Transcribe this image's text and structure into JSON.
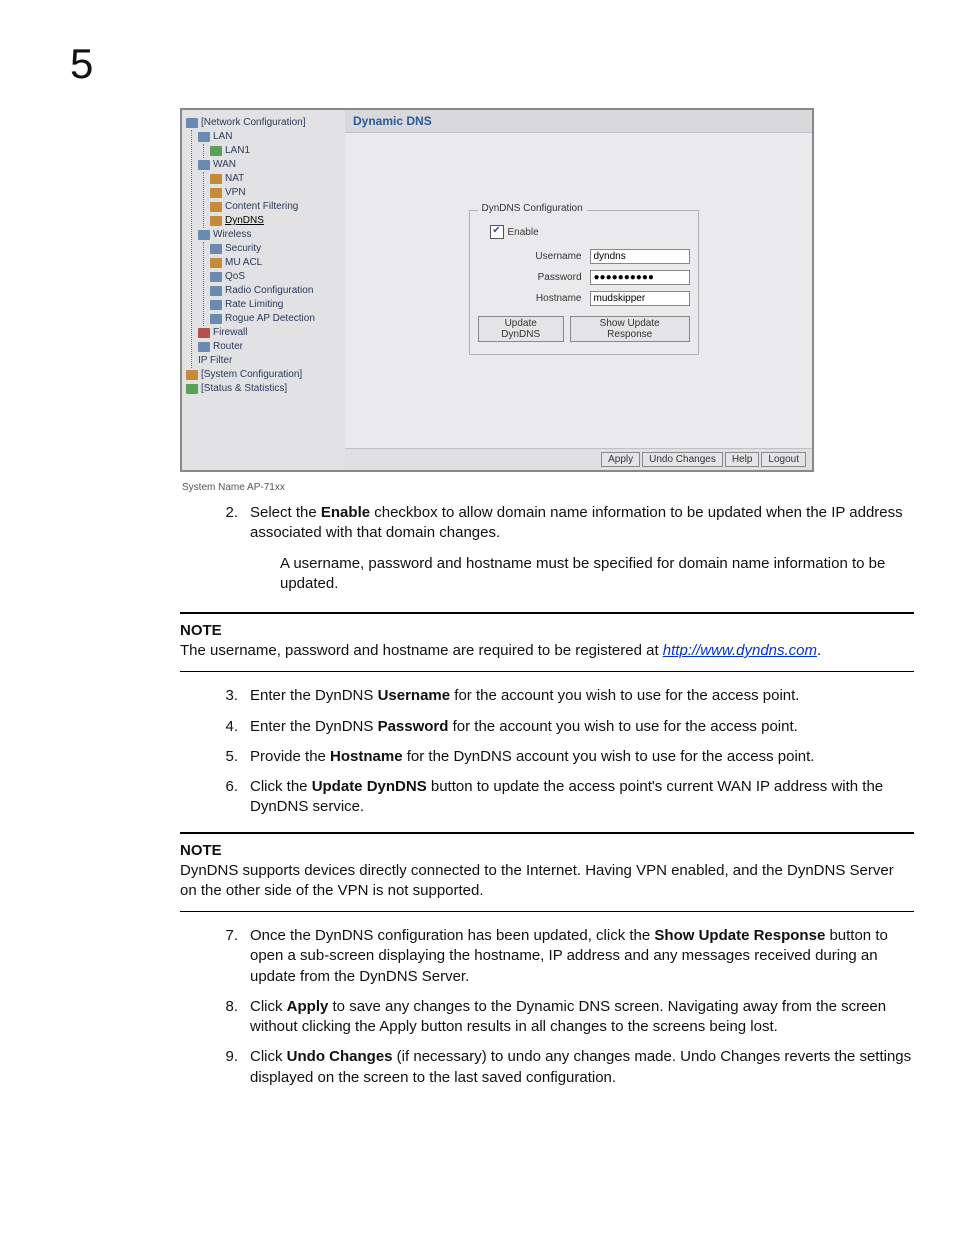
{
  "chapter": "5",
  "screenshot": {
    "tree": {
      "root": "[Network Configuration]",
      "lan": "LAN",
      "lan1": "LAN1",
      "wan": "WAN",
      "nat": "NAT",
      "vpn": "VPN",
      "cf": "Content Filtering",
      "dyndns": "DynDNS",
      "wireless": "Wireless",
      "security": "Security",
      "muacl": "MU ACL",
      "qos": "QoS",
      "radio": "Radio Configuration",
      "rate": "Rate Limiting",
      "rogue": "Rogue AP Detection",
      "firewall": "Firewall",
      "router": "Router",
      "ipfilter": "IP Filter",
      "syscfg": "[System Configuration]",
      "stats": "[Status & Statistics]"
    },
    "title": "Dynamic DNS",
    "form": {
      "legend": "DynDNS Configuration",
      "enable_label": "Enable",
      "enable_checked": "✔",
      "username_label": "Username",
      "username_value": "dyndns",
      "password_label": "Password",
      "password_value": "●●●●●●●●●●",
      "hostname_label": "Hostname",
      "hostname_value": "mudskipper",
      "btn_update": "Update DynDNS",
      "btn_show": "Show Update Response"
    },
    "footer": {
      "apply": "Apply",
      "undo": "Undo Changes",
      "help": "Help",
      "logout": "Logout"
    },
    "system_name": "System Name AP-71xx"
  },
  "steps": {
    "s2n": "2.",
    "s2": "Select the Enable checkbox to allow domain name information to be updated when the IP address associated with that domain changes.",
    "s2sub": "A username, password and hostname must be specified for domain name information to be updated.",
    "s3n": "3.",
    "s3": "Enter the DynDNS Username for the account you wish to use for the access point.",
    "s4n": "4.",
    "s4": "Enter the DynDNS Password for the account you wish to use for the access point.",
    "s5n": "5.",
    "s5": "Provide the Hostname for the DynDNS account you wish to use for the access point.",
    "s6n": "6.",
    "s6": "Click the Update DynDNS button to update the access point's current WAN IP address with the DynDNS service.",
    "s7n": "7.",
    "s7": "Once the DynDNS configuration has been updated, click the Show Update Response button to open a sub-screen displaying the hostname, IP address and any messages received during an update from the DynDNS Server.",
    "s8n": "8.",
    "s8": "Click Apply to save any changes to the Dynamic DNS screen. Navigating away from the screen without clicking the Apply button results in all changes to the screens being lost.",
    "s9n": "9.",
    "s9": "Click Undo Changes (if necessary) to undo any changes made. Undo Changes reverts the settings displayed on the screen to the last saved configuration."
  },
  "notes": {
    "title": "NOTE",
    "n1a": "The username, password and hostname are required to be registered at ",
    "n1link": "http://www.dyndns.com",
    "n1b": ".",
    "n2": "DynDNS supports devices directly connected to the Internet. Having VPN enabled, and the DynDNS Server on the other side of the VPN is not supported."
  }
}
